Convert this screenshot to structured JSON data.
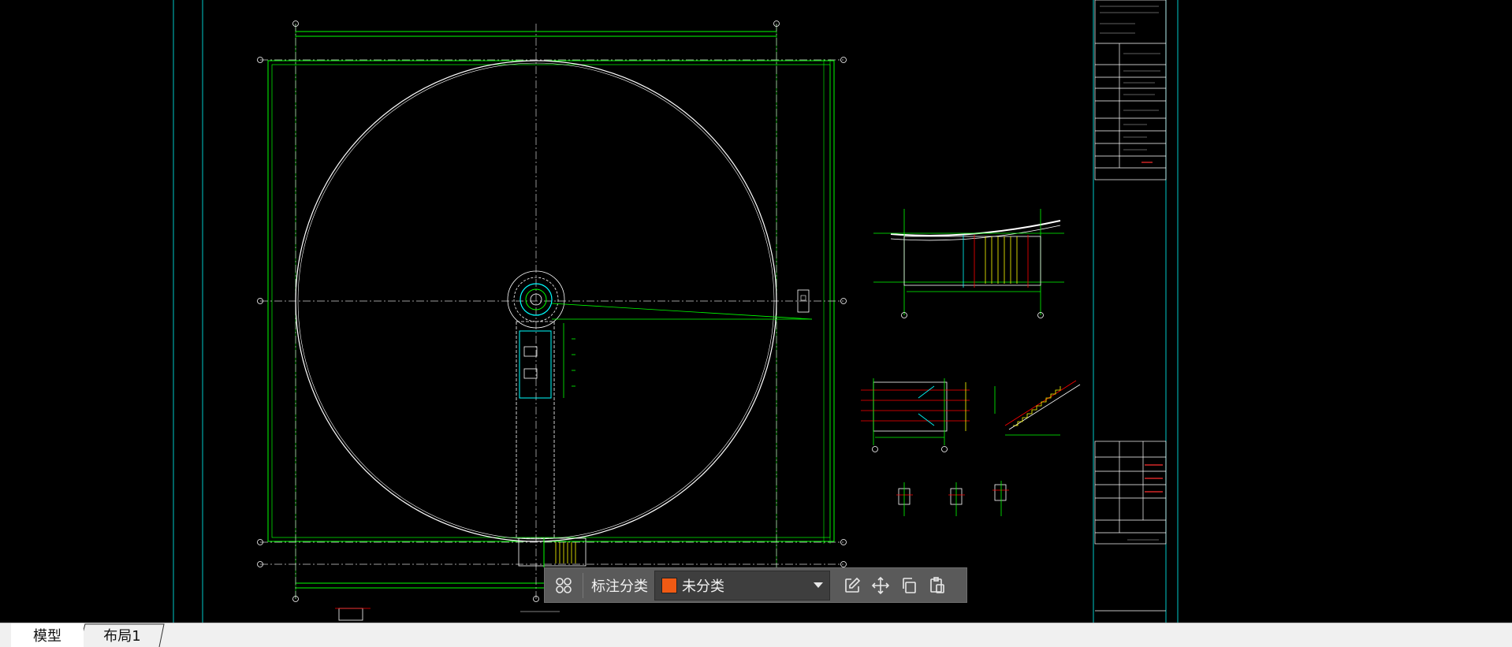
{
  "toolbar": {
    "label": "标注分类",
    "category_value": "未分类",
    "category_color": "#f05a14",
    "icons": [
      "grid-icon",
      "edit-icon",
      "move-icon",
      "copy-icon",
      "paste-icon"
    ]
  },
  "tabs": [
    {
      "label": "模型",
      "active": true
    },
    {
      "label": "布局1",
      "active": false
    }
  ],
  "colors": {
    "background": "#000000",
    "line_white": "#ffffff",
    "line_green": "#00ff00",
    "line_cyan": "#00ffff",
    "line_yellow": "#ffff00",
    "line_red": "#ff0000"
  }
}
